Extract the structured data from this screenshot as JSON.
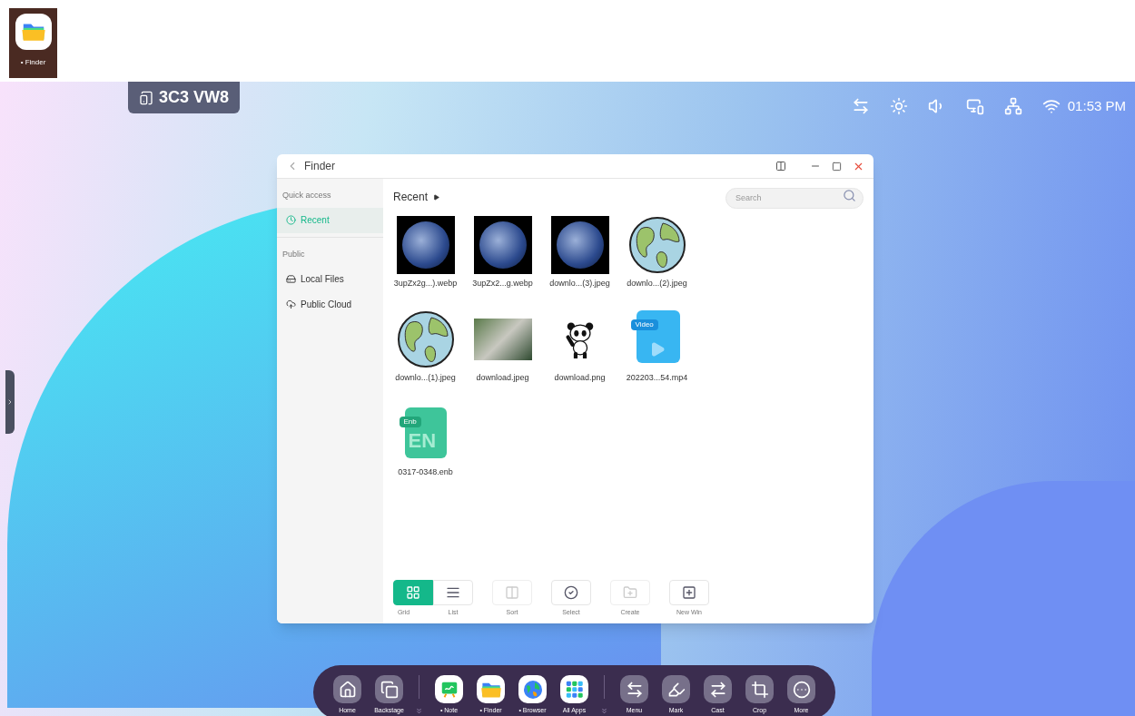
{
  "thumbnail": {
    "label": "• Finder"
  },
  "device_code": "3C3 VW8",
  "status_bar": {
    "time": "01:53 PM"
  },
  "finder": {
    "title": "Finder",
    "sidebar": [
      {
        "heading": "Quick access",
        "items": [
          {
            "label": "Recent",
            "selected": true
          }
        ]
      },
      {
        "heading": "Public",
        "items": [
          {
            "label": "Local Files",
            "selected": false
          },
          {
            "label": "Public Cloud",
            "selected": false
          }
        ]
      }
    ],
    "breadcrumb": "Recent",
    "search": {
      "placeholder": "Search"
    },
    "files": [
      {
        "name": "3upZx2g...).webp",
        "kind": "photo"
      },
      {
        "name": "3upZx2...g.webp",
        "kind": "photo"
      },
      {
        "name": "downlo...(3).jpeg",
        "kind": "photo"
      },
      {
        "name": "downlo...(2).jpeg",
        "kind": "globe"
      },
      {
        "name": "downlo...(1).jpeg",
        "kind": "globe"
      },
      {
        "name": "download.jpeg",
        "kind": "photo-wide"
      },
      {
        "name": "download.png",
        "kind": "panda"
      },
      {
        "name": "202203...54.mp4",
        "kind": "video",
        "badge": "Video"
      },
      {
        "name": "0317-0348.enb",
        "kind": "enb",
        "badge": "Enb",
        "letters": "EN"
      }
    ],
    "toolbar": [
      {
        "label": "Grid",
        "selected": true,
        "disabled": false
      },
      {
        "label": "List",
        "selected": false,
        "disabled": false
      },
      {
        "label": "Sort",
        "selected": false,
        "disabled": true
      },
      {
        "label": "Select",
        "selected": false,
        "disabled": false
      },
      {
        "label": "Create",
        "selected": false,
        "disabled": true
      },
      {
        "label": "New Win",
        "selected": false,
        "disabled": false
      }
    ]
  },
  "dock": [
    {
      "label": "Home",
      "kind": "tool"
    },
    {
      "label": "Backstage",
      "kind": "tool"
    },
    {
      "kind": "more-toggle"
    },
    {
      "label": "• Note",
      "kind": "app"
    },
    {
      "label": "• Finder",
      "kind": "app"
    },
    {
      "label": "• Browser",
      "kind": "app"
    },
    {
      "label": "All Apps",
      "kind": "app"
    },
    {
      "kind": "more-toggle"
    },
    {
      "label": "Menu",
      "kind": "tool"
    },
    {
      "label": "Mark",
      "kind": "tool"
    },
    {
      "label": "Cast",
      "kind": "tool"
    },
    {
      "label": "Crop",
      "kind": "tool"
    },
    {
      "label": "More",
      "kind": "tool"
    }
  ]
}
